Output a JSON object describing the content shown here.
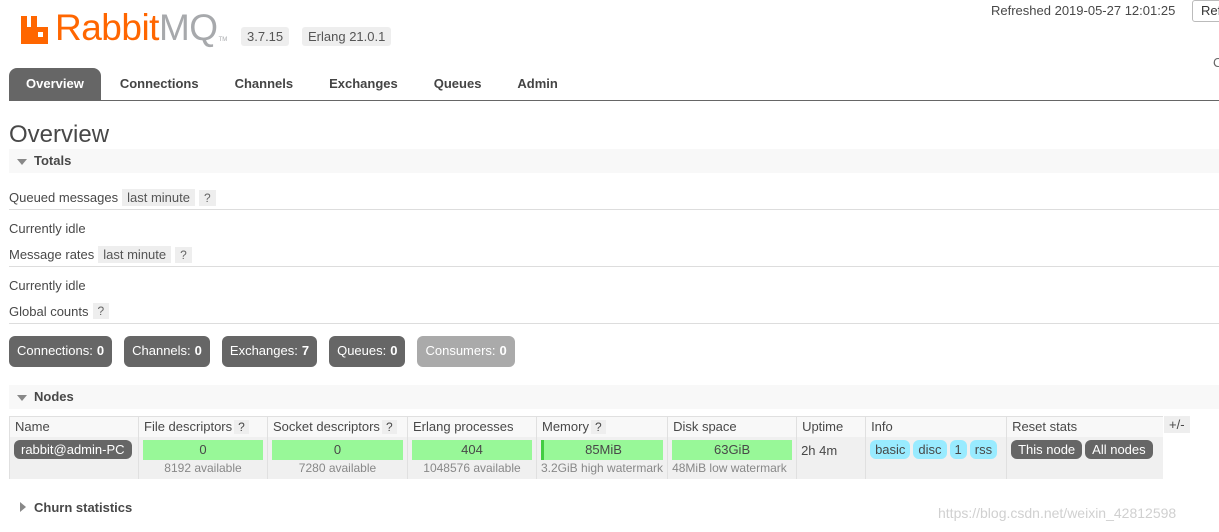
{
  "header": {
    "logo_rabbit": "Rabbit",
    "logo_mq": "MQ",
    "logo_tm": "TM",
    "version": "3.7.15",
    "erlang": "Erlang 21.0.1",
    "refreshed": "Refreshed 2019-05-27 12:01:25",
    "refresh_button": "Ref",
    "right_cut": "C"
  },
  "tabs": [
    "Overview",
    "Connections",
    "Channels",
    "Exchanges",
    "Queues",
    "Admin"
  ],
  "page_title": "Overview",
  "totals": {
    "heading": "Totals",
    "queued_label": "Queued messages",
    "queued_range": "last minute",
    "queued_status": "Currently idle",
    "rates_label": "Message rates",
    "rates_range": "last minute",
    "rates_status": "Currently idle",
    "global_label": "Global counts",
    "help": "?"
  },
  "counts": [
    {
      "label": "Connections:",
      "value": "0"
    },
    {
      "label": "Channels:",
      "value": "0"
    },
    {
      "label": "Exchanges:",
      "value": "7"
    },
    {
      "label": "Queues:",
      "value": "0"
    },
    {
      "label": "Consumers:",
      "value": "0"
    }
  ],
  "nodes": {
    "heading": "Nodes",
    "columns": {
      "name": "Name",
      "fd": "File descriptors",
      "sd": "Socket descriptors",
      "ep": "Erlang processes",
      "mem": "Memory",
      "disk": "Disk space",
      "uptime": "Uptime",
      "info": "Info",
      "reset": "Reset stats"
    },
    "plusminus": "+/-",
    "row": {
      "name": "rabbit@admin-PC",
      "fd": "0",
      "fd_avail": "8192 available",
      "sd": "0",
      "sd_avail": "7280 available",
      "ep": "404",
      "ep_avail": "1048576 available",
      "mem": "85MiB",
      "mem_sub": "3.2GiB high watermark",
      "disk": "63GiB",
      "disk_sub": "48MiB low watermark",
      "uptime": "2h 4m",
      "info_tags": [
        "basic",
        "disc",
        "1",
        "rss"
      ],
      "reset_this": "This node",
      "reset_all": "All nodes"
    }
  },
  "churn": {
    "heading": "Churn statistics"
  },
  "watermark": "https://blog.csdn.net/weixin_42812598",
  "colors": {
    "brand": "#ff6600",
    "bar_green": "#98f898",
    "tag_blue": "#99ebff",
    "tab_active": "#666666"
  }
}
